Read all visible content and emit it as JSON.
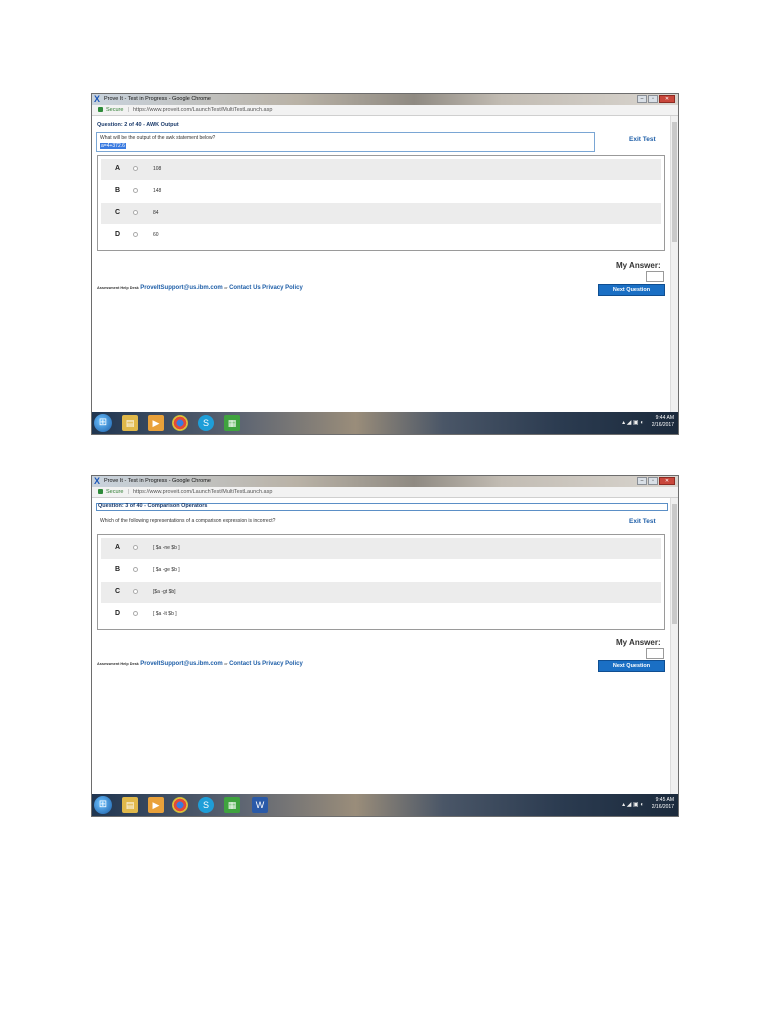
{
  "screens": [
    {
      "window_title": "Prove It - Test in Progress - Google Chrome",
      "secure_label": "Secure",
      "url": "https://www.proveit.com/LaunchTest/MultiTestLaunch.asp",
      "question_header": "Question:  2 of  40  -  AWK Output",
      "question_text": "What will be the output of the awk statement below?",
      "question_code": "a=4+372.6",
      "exit_label": "Exit Test",
      "options": [
        {
          "letter": "A",
          "text": "108"
        },
        {
          "letter": "B",
          "text": "148"
        },
        {
          "letter": "C",
          "text": "84"
        },
        {
          "letter": "D",
          "text": "60"
        }
      ],
      "my_answer_label": "My Answer:",
      "footer": {
        "help_desk_label": "Assessment Help Desk",
        "email": "ProveItSupport@us.ibm.com",
        "or_text": "or",
        "contact": "Contact Us",
        "privacy": "Privacy Policy"
      },
      "next_label": "Next Question",
      "clock_time": "9:44 AM",
      "clock_date": "2/16/2017"
    },
    {
      "window_title": "Prove It - Test in Progress - Google Chrome",
      "secure_label": "Secure",
      "url": "https://www.proveit.com/LaunchTest/MultiTestLaunch.asp",
      "question_header": "Question:  3 of  40  -  Comparison Operators",
      "question_text": "Which of the following representations of a comparison expression is incorrect?",
      "exit_label": "Exit Test",
      "options": [
        {
          "letter": "A",
          "text": "[ $a -ne $b ]"
        },
        {
          "letter": "B",
          "text": "[ $a -ge $b ]"
        },
        {
          "letter": "C",
          "text": "[$a -gt $b]"
        },
        {
          "letter": "D",
          "text": "[ $a -lt $b ]"
        }
      ],
      "my_answer_label": "My Answer:",
      "footer": {
        "help_desk_label": "Assessment Help Desk",
        "email": "ProveItSupport@us.ibm.com",
        "or_text": "or",
        "contact": "Contact Us",
        "privacy": "Privacy Policy"
      },
      "next_label": "Next Question",
      "clock_time": "9:45 AM",
      "clock_date": "2/16/2017"
    }
  ],
  "icons": {
    "app": "proveit-x-icon",
    "lock": "lock-icon",
    "start": "windows-start-icon",
    "folder": "folder-icon",
    "media": "media-player-icon",
    "chrome": "chrome-icon",
    "skype": "skype-icon",
    "project": "project-icon",
    "word": "word-icon"
  },
  "colors": {
    "link_blue": "#1f5fa8",
    "button_blue": "#1a6fc4",
    "row_shade": "#ececec"
  }
}
